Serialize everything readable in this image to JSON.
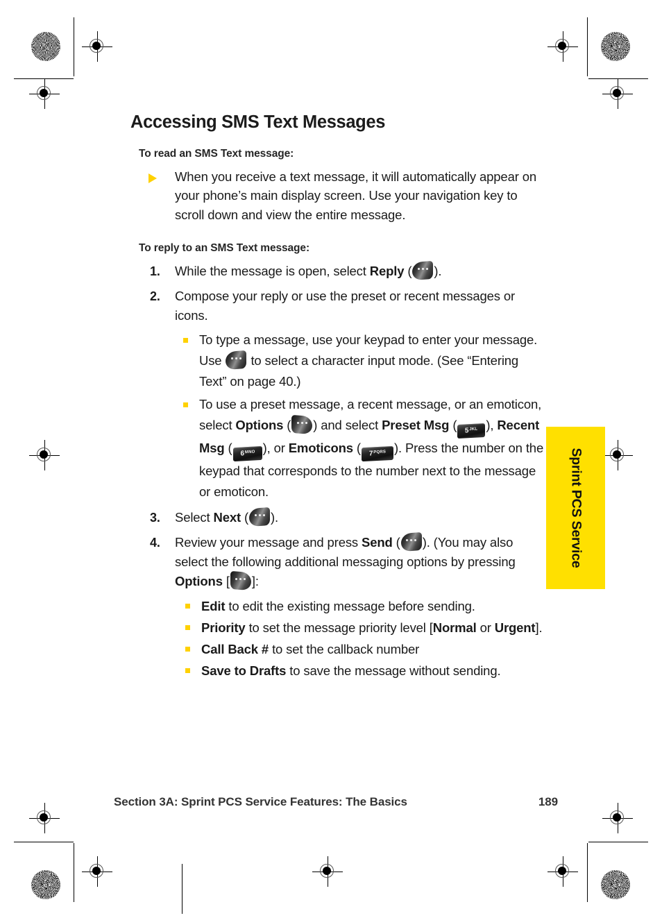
{
  "document": {
    "title": "Accessing SMS Text Messages",
    "footer": {
      "section": "Section 3A: Sprint PCS Service Features: The Basics",
      "page_number": "189"
    },
    "side_tab": {
      "label": "Sprint PCS Service",
      "color": "#FFE000"
    },
    "accent_color": "#FFD100"
  },
  "sections": {
    "read": {
      "subhead": "To read an SMS Text message:",
      "bullet": "When you receive a text message, it will automatically appear on your phone’s main display screen. Use your navigation key to scroll down and view the entire message."
    },
    "reply": {
      "subhead": "To reply to an SMS Text message:",
      "steps": [
        {
          "number": "1.",
          "prefix": "While the message is open, select ",
          "bold": "Reply",
          "open": " (",
          "icon": "left-softkey-icon",
          "suffix": ")."
        },
        {
          "number": "2.",
          "text": "Compose your reply or use the preset or recent messages or icons.",
          "sub_bullets": [
            {
              "part1": "To type a message, use your keypad to enter your message. Use ",
              "icon": "left-softkey-icon",
              "part2": " to select a character input mode. (See “Entering Text” on page 40.)"
            },
            {
              "part1": "To use a preset message, a recent message, or an emoticon, select ",
              "bold1": "Options",
              "mid1": " (",
              "icon1": "right-softkey-icon",
              "mid2": ") and select ",
              "bold2": "Preset Msg",
              "mid3": " (",
              "key1_digit": "5",
              "key1_letters": "JKL",
              "mid4": "), ",
              "bold3": "Recent Msg",
              "mid5": " (",
              "key2_digit": "6",
              "key2_letters": "MNO",
              "mid6": "), or ",
              "bold4": "Emoticons",
              "mid7": " (",
              "key3_digit": "7",
              "key3_letters": "PQRS",
              "tail": "). Press the number on the keypad that corresponds to the number next to the message or emoticon."
            }
          ]
        },
        {
          "number": "3.",
          "prefix": "Select ",
          "bold": "Next",
          "open": " (",
          "icon": "left-softkey-icon",
          "suffix": ")."
        },
        {
          "number": "4.",
          "prefix": "Review your message and press ",
          "bold": "Send",
          "open": " (",
          "icon": "left-softkey-icon",
          "mid": "). (You may also select the following additional messaging options by pressing ",
          "bold2": "Options",
          "open2": " [",
          "icon2": "right-softkey-icon",
          "suffix": "]:",
          "options": [
            {
              "bold": "Edit",
              "text": " to edit the existing message before sending."
            },
            {
              "bold": "Priority",
              "text": " to set the message priority level [",
              "bold2": "Normal",
              "text2": " or ",
              "bold3": "Urgent",
              "text3": "]."
            },
            {
              "bold": "Call Back #",
              "text": " to set the callback number"
            },
            {
              "bold": "Save to Drafts",
              "text": " to save the message without sending."
            }
          ]
        }
      ]
    }
  },
  "print_marks": {
    "targets": "registration-crosshair",
    "starbursts": "print-calibration-star"
  }
}
